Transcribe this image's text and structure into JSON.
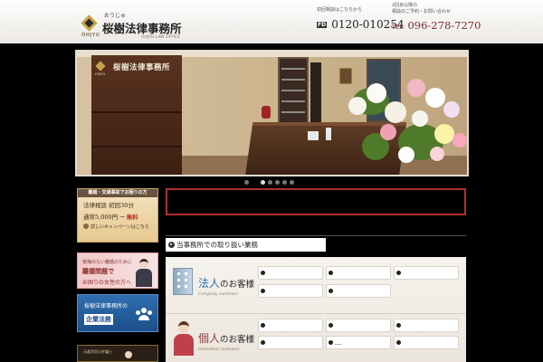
{
  "header": {
    "logo_ruby": "おうじゅ",
    "logo_name": "桜樹法律事務所",
    "logo_sub": "OHJYU",
    "logo_english": "OHJYU LAW OFFICE",
    "first_contact_note": "初回相談はこちらから",
    "freedial_badge": "FD",
    "freedial_number": "0120-010254",
    "second_contact_note_1": "2回目以降の",
    "second_contact_note_2": "相談のご予約・お問い合わせ",
    "tel_label": "TEL",
    "tel_number": "096-278-7270"
  },
  "hero": {
    "panel_text": "桜樹法律事務所",
    "panel_sub": "OHJYU",
    "slide_count": 6,
    "active_slide": 1
  },
  "sidebar": {
    "consult_head": "離婚・交通事故でお困りの方",
    "consult_line1": "法律相談 初回30分",
    "consult_price": "通常5,000円 →",
    "consult_free": "無料",
    "consult_campaign": "詳しいキャンペーンはこちら",
    "divorce_line1": "後悔のない離婚のために",
    "divorce_line2": "離婚問題で",
    "divorce_line3": "お困りの女性の方へ",
    "corp_line1": "桜樹法律事務所の",
    "corp_line2": "企業法務",
    "extra_line1": "元裁判官の弁護士"
  },
  "main": {
    "section_title": "当事務所での取り扱い業務",
    "section_bullet": "▸",
    "corp_jp_accent": "法人",
    "corp_jp_rest": "のお客様",
    "corp_en": "Company customer",
    "indiv_jp_accent": "個人",
    "indiv_jp_rest": "のお客様",
    "indiv_en": "Individual customer",
    "corp_items": [
      "",
      "",
      "",
      "",
      ""
    ],
    "indiv_items": [
      "",
      "",
      "",
      "",
      "___",
      ""
    ]
  },
  "colors": {
    "accent_red": "#b03030",
    "corp_blue": "#2f6fb0",
    "gold": "#c8a24a"
  }
}
